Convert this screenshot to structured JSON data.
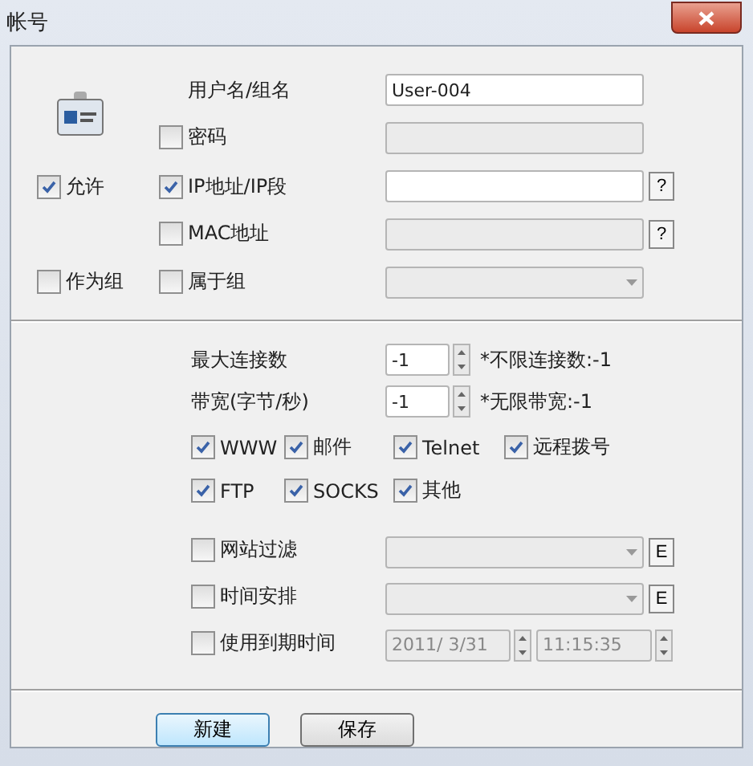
{
  "window": {
    "title": "帐号"
  },
  "account": {
    "allow": {
      "label": "允许",
      "checked": true
    },
    "as_group": {
      "label": "作为组",
      "checked": false
    },
    "username": {
      "label": "用户名/组名",
      "value": "User-004"
    },
    "password": {
      "label": "密码",
      "checked": false
    },
    "ip": {
      "label": "IP地址/IP段",
      "checked": true,
      "help": "?"
    },
    "mac": {
      "label": "MAC地址",
      "checked": false,
      "help": "?"
    },
    "member_of": {
      "label": "属于组",
      "checked": false
    }
  },
  "limits": [
    {
      "label": "最大连接数",
      "value": "-1",
      "note": "*不限连接数:-1"
    },
    {
      "label": "带宽(字节/秒)",
      "value": "-1",
      "note": "*无限带宽:-1"
    }
  ],
  "services": [
    {
      "label": "WWW",
      "checked": true
    },
    {
      "label": "邮件",
      "checked": true
    },
    {
      "label": "Telnet",
      "checked": true
    },
    {
      "label": "远程拨号",
      "checked": true
    },
    {
      "label": "FTP",
      "checked": true
    },
    {
      "label": "SOCKS",
      "checked": true
    },
    {
      "label": "其他",
      "checked": true
    }
  ],
  "options": [
    {
      "kind": "dropdown",
      "label": "网站过滤",
      "checked": false,
      "edit": "E"
    },
    {
      "kind": "dropdown",
      "label": "时间安排",
      "checked": false,
      "edit": "E"
    },
    {
      "kind": "datetime",
      "label": "使用到期时间",
      "checked": false,
      "date": "2011/ 3/31",
      "time": "11:15:35"
    }
  ],
  "buttons": [
    {
      "label": "新建",
      "selected": true
    },
    {
      "label": "保存",
      "selected": false
    }
  ]
}
